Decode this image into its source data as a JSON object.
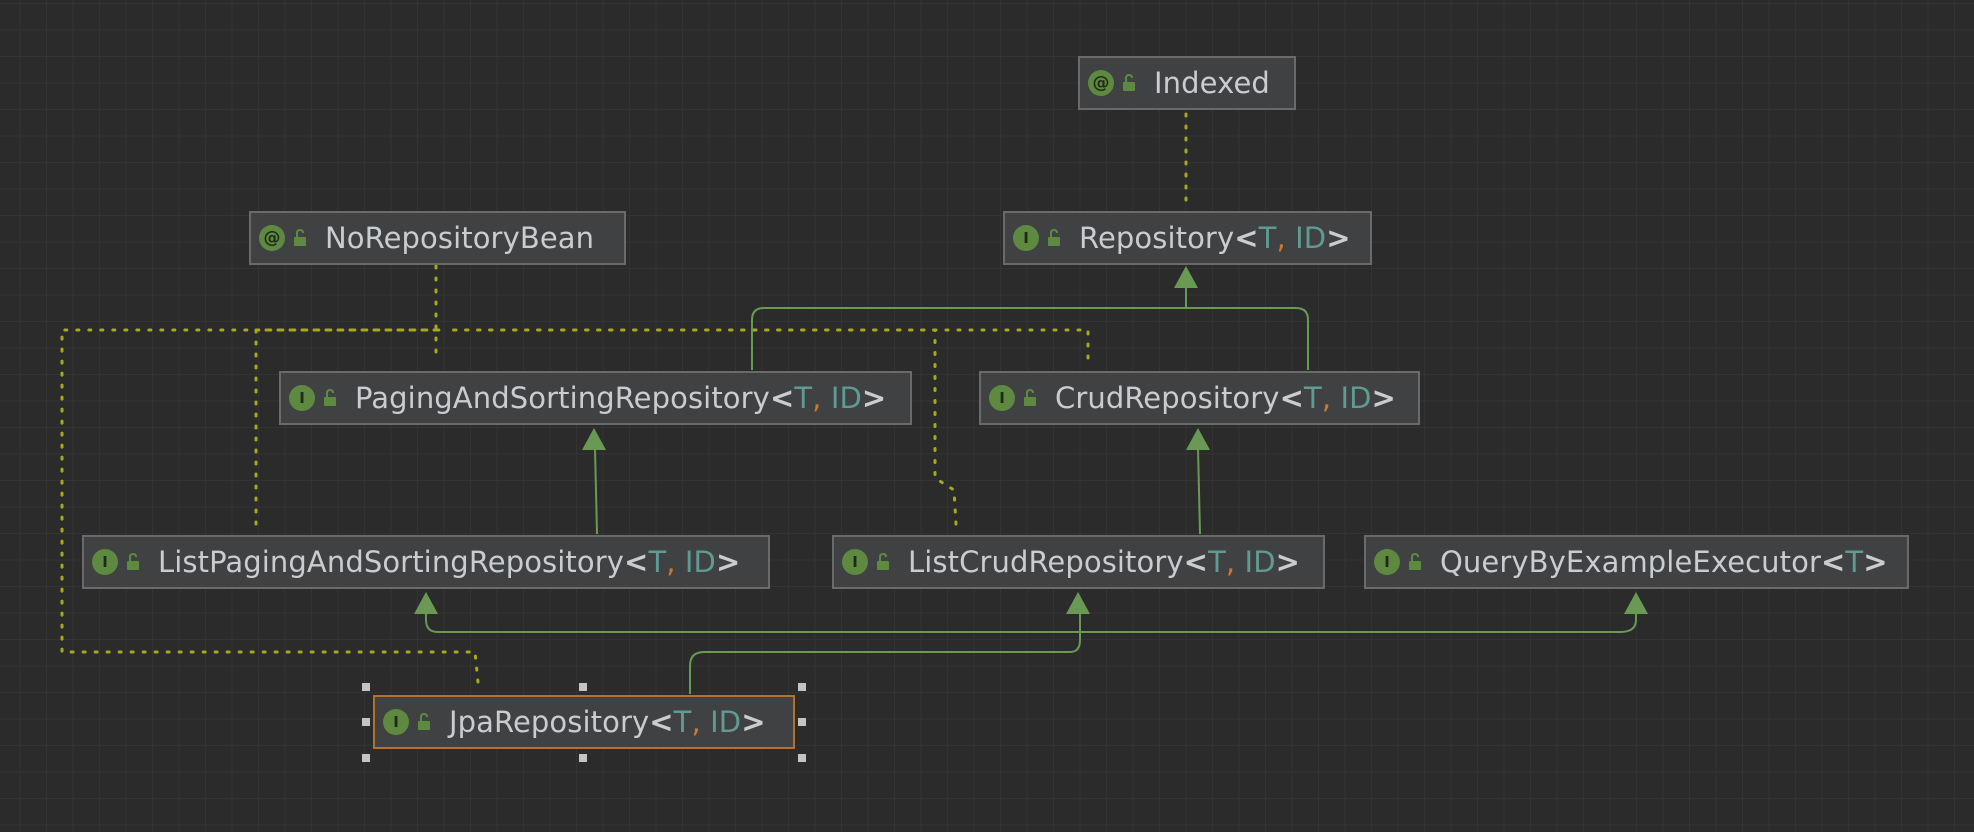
{
  "diagram": {
    "nodes": {
      "indexed": {
        "kind": "@",
        "name": "Indexed",
        "params": []
      },
      "no_repository_bean": {
        "kind": "@",
        "name": "NoRepositoryBean",
        "params": []
      },
      "repository": {
        "kind": "I",
        "name": "Repository",
        "params": [
          "T",
          "ID"
        ]
      },
      "paging_and_sorting_repository": {
        "kind": "I",
        "name": "PagingAndSortingRepository",
        "params": [
          "T",
          "ID"
        ]
      },
      "crud_repository": {
        "kind": "I",
        "name": "CrudRepository",
        "params": [
          "T",
          "ID"
        ]
      },
      "list_paging_and_sorting_repository": {
        "kind": "I",
        "name": "ListPagingAndSortingRepository",
        "params": [
          "T",
          "ID"
        ]
      },
      "list_crud_repository": {
        "kind": "I",
        "name": "ListCrudRepository",
        "params": [
          "T",
          "ID"
        ]
      },
      "query_by_example_executor": {
        "kind": "I",
        "name": "QueryByExampleExecutor",
        "params": [
          "T"
        ]
      },
      "jpa_repository": {
        "kind": "I",
        "name": "JpaRepository",
        "params": [
          "T",
          "ID"
        ]
      }
    },
    "selected_node": "jpa_repository",
    "colors": {
      "inheritance_edge": "#6a9955",
      "annotation_edge": "#a8a820",
      "kind_badge": "#5d8a40",
      "type_param": "#5f9a93",
      "comma": "#cc7832",
      "selection_border": "#b5702d"
    },
    "edge_legend": {
      "solid_with_arrow": "extends",
      "dotted": "annotated-by"
    }
  }
}
